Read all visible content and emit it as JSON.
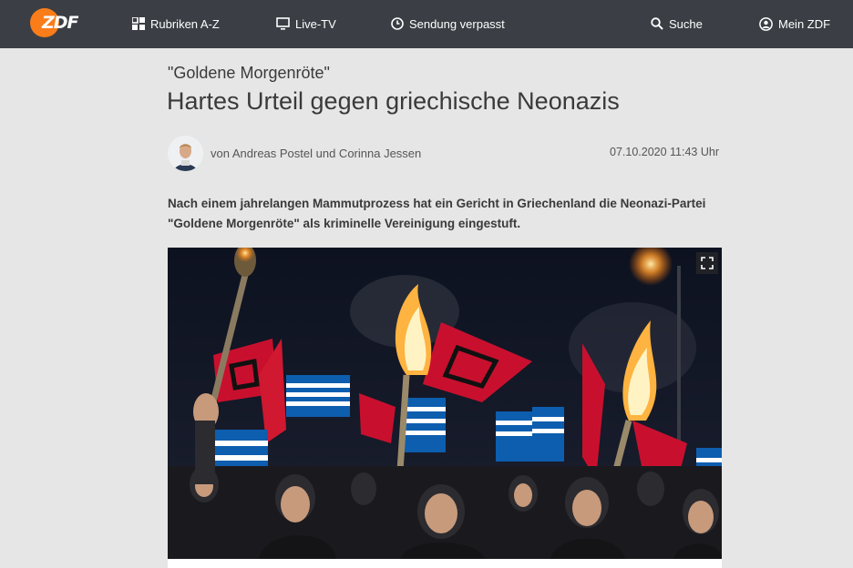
{
  "header": {
    "logo_text": "ZDF",
    "brand_color": "#fa7d19",
    "nav": [
      {
        "label": "Rubriken A-Z",
        "icon": "grid-icon"
      },
      {
        "label": "Live-TV",
        "icon": "monitor-icon"
      },
      {
        "label": "Sendung verpasst",
        "icon": "clock-icon"
      },
      {
        "label": "Suche",
        "icon": "search-icon"
      },
      {
        "label": "Mein ZDF",
        "icon": "user-icon"
      }
    ]
  },
  "article": {
    "kicker": "\"Goldene Morgenröte\"",
    "headline": "Hartes Urteil gegen griechische Neonazis",
    "byline": "von Andreas Postel und Corinna Jessen",
    "date": "07.10.2020 11:43 Uhr",
    "lead": "Nach einem jahrelangen Mammutprozess hat ein Gericht in Griechenland die Neonazi-Partei \"Goldene Morgenröte\" als kriminelle Vereinigung eingestuft."
  }
}
